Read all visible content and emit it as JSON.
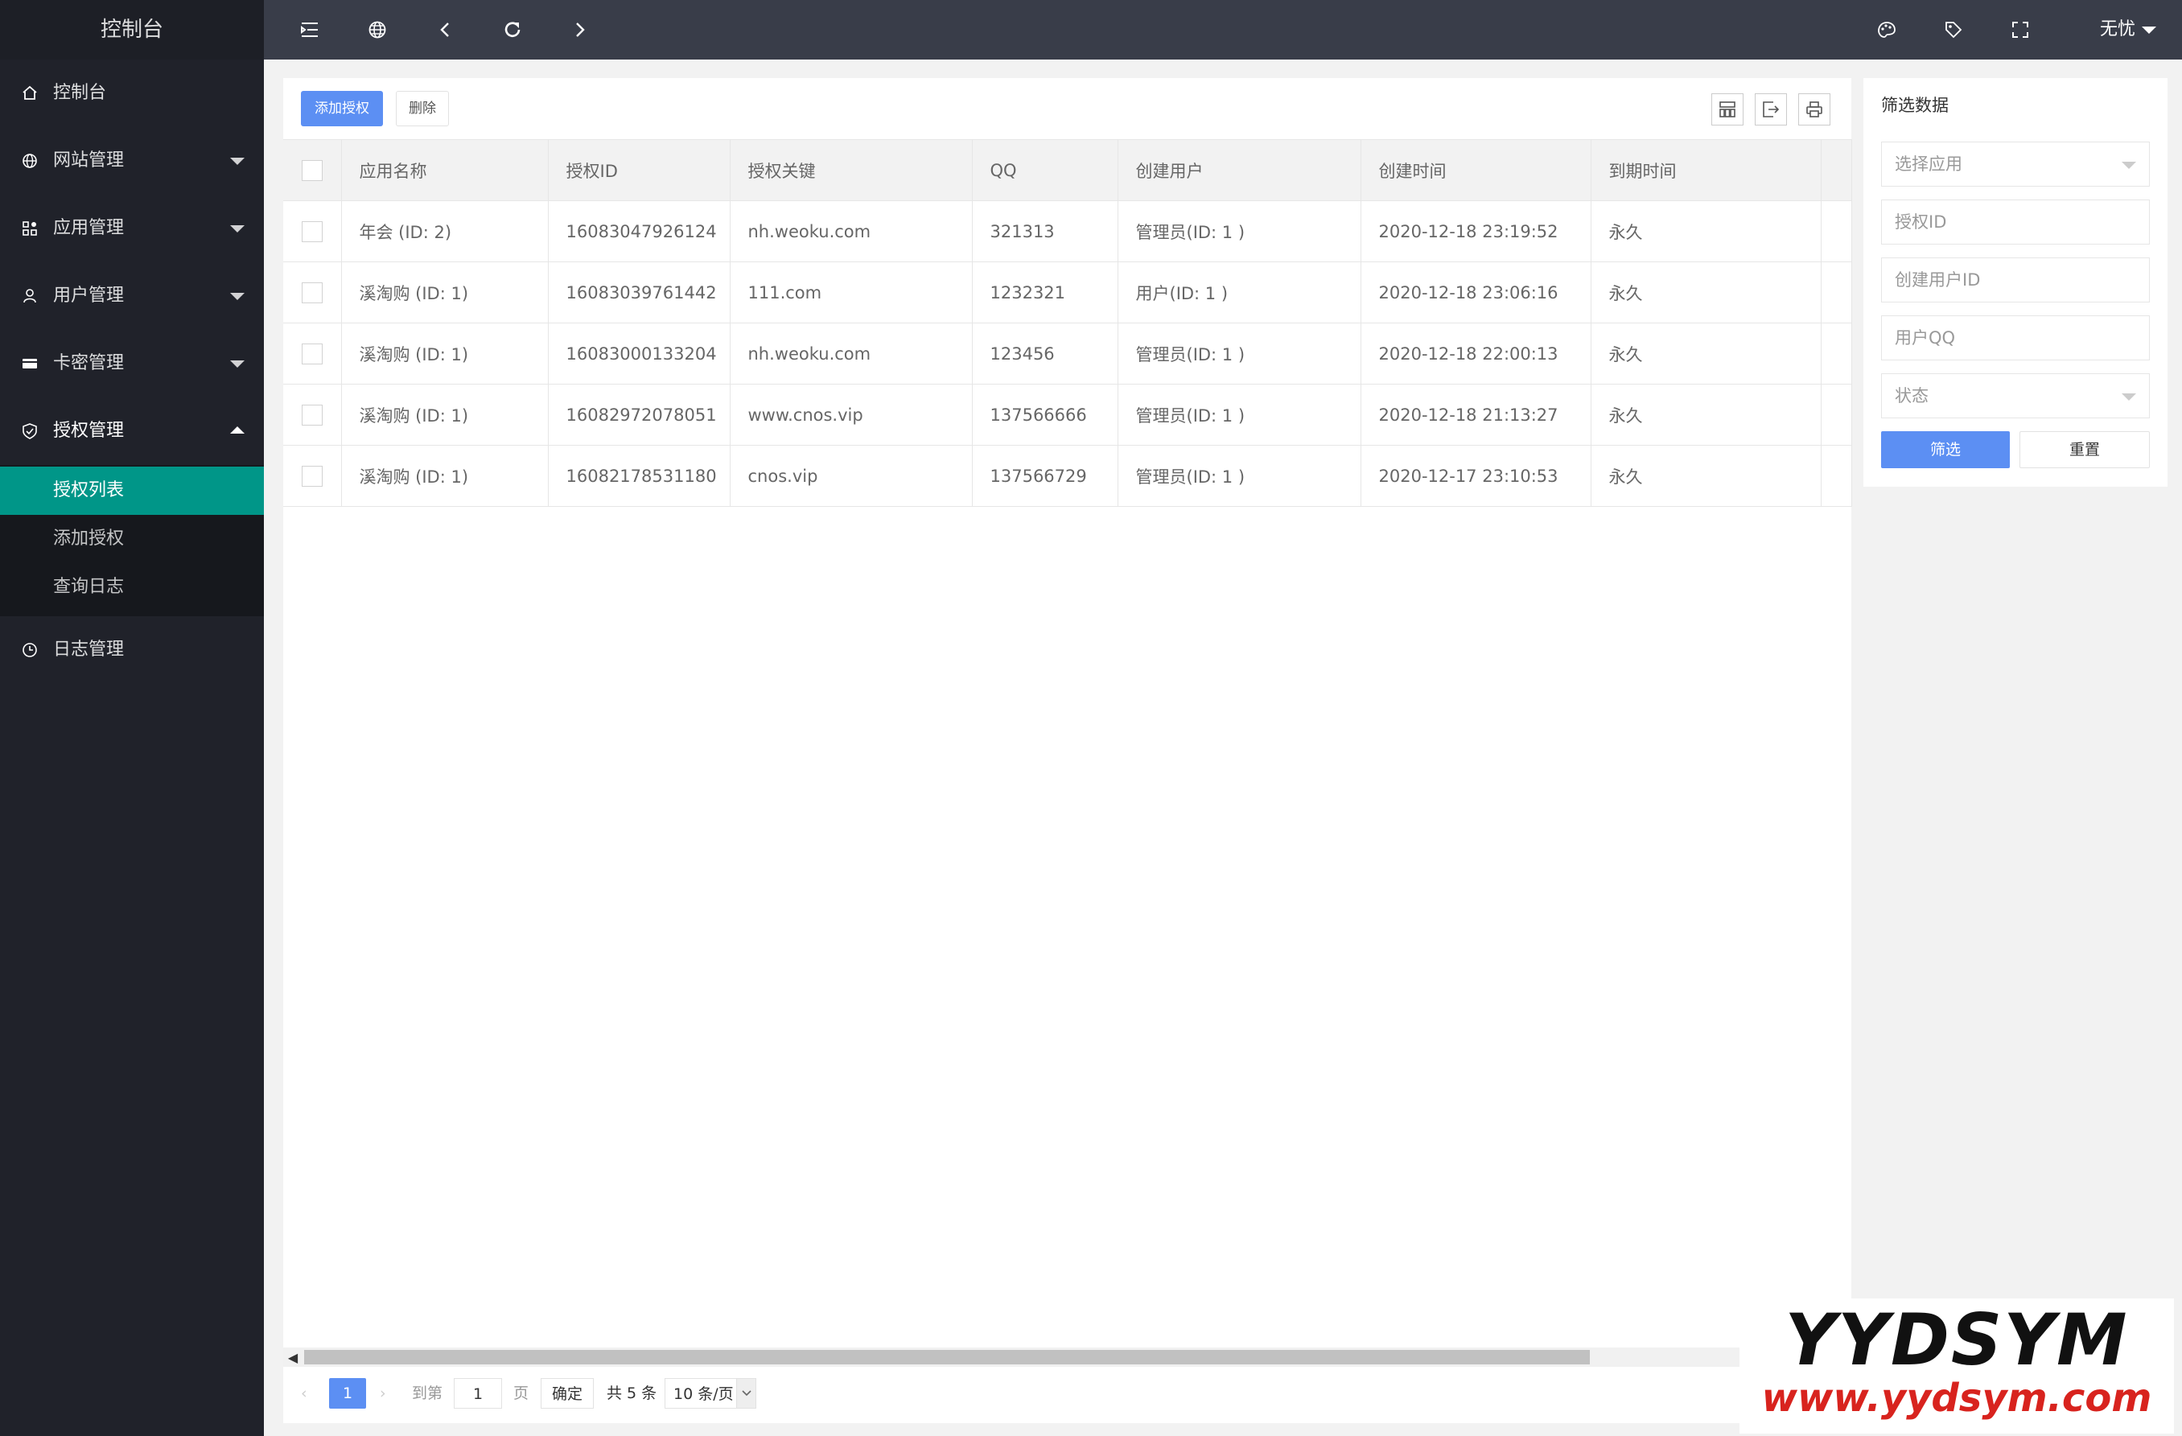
{
  "sidebar": {
    "title": "控制台",
    "items": [
      {
        "label": "控制台",
        "icon": "home-icon"
      },
      {
        "label": "网站管理",
        "icon": "globe-icon"
      },
      {
        "label": "应用管理",
        "icon": "apps-icon"
      },
      {
        "label": "用户管理",
        "icon": "user-icon"
      },
      {
        "label": "卡密管理",
        "icon": "card-icon"
      },
      {
        "label": "授权管理",
        "icon": "shield-icon"
      },
      {
        "label": "日志管理",
        "icon": "clock-icon"
      }
    ],
    "submenu": [
      {
        "label": "授权列表",
        "active": true
      },
      {
        "label": "添加授权"
      },
      {
        "label": "查询日志"
      }
    ],
    "active_color": "#009688"
  },
  "header": {
    "icons": [
      "menu-fold-icon",
      "globe-icon",
      "back-icon",
      "refresh-icon",
      "forward-icon",
      "theme-icon",
      "tag-icon",
      "fullscreen-icon"
    ],
    "user": "无忧"
  },
  "toolbar": {
    "add_label": "添加授权",
    "delete_label": "删除",
    "icons": [
      "columns-icon",
      "export-icon",
      "print-icon"
    ]
  },
  "table": {
    "columns": [
      "应用名称",
      "授权ID",
      "授权关键",
      "QQ",
      "创建用户",
      "创建时间",
      "到期时间"
    ],
    "rows": [
      [
        "年会 (ID: 2)",
        "16083047926124",
        "nh.weoku.com",
        "321313",
        "管理员(ID: 1 )",
        "2020-12-18 23:19:52",
        "永久"
      ],
      [
        "溪淘购 (ID: 1)",
        "16083039761442",
        "111.com",
        "1232321",
        "用户(ID: 1 )",
        "2020-12-18 23:06:16",
        "永久"
      ],
      [
        "溪淘购 (ID: 1)",
        "16083000133204",
        "nh.weoku.com",
        "123456",
        "管理员(ID: 1 )",
        "2020-12-18 22:00:13",
        "永久"
      ],
      [
        "溪淘购 (ID: 1)",
        "16082972078051",
        "www.cnos.vip",
        "137566666",
        "管理员(ID: 1 )",
        "2020-12-18 21:13:27",
        "永久"
      ],
      [
        "溪淘购 (ID: 1)",
        "16082178531180",
        "cnos.vip",
        "137566729",
        "管理员(ID: 1 )",
        "2020-12-17 23:10:53",
        "永久"
      ]
    ]
  },
  "pager": {
    "current": "1",
    "goto_label": "到第",
    "goto_value": "1",
    "page_unit": "页",
    "confirm": "确定",
    "total": "共 5 条",
    "per_page": "10 条/页"
  },
  "filter": {
    "title": "筛选数据",
    "app_placeholder": "选择应用",
    "auth_id_placeholder": "授权ID",
    "creator_placeholder": "创建用户ID",
    "qq_placeholder": "用户QQ",
    "status_placeholder": "状态",
    "submit": "筛选",
    "reset": "重置"
  },
  "watermark": {
    "brand": "YYDSYM",
    "url": "www.yydsym.com"
  },
  "colors": {
    "sidebar_bg": "#20222a",
    "header_bg": "#393d49",
    "primary": "#5c8ff3",
    "teal": "#009688"
  }
}
